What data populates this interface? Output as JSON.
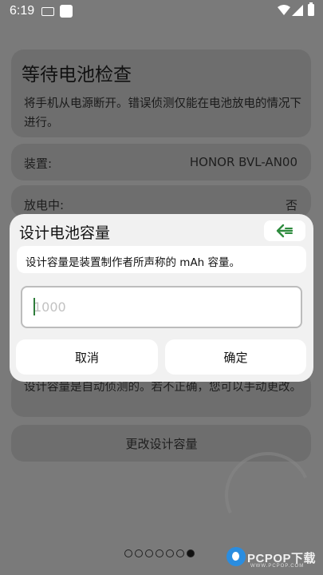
{
  "status": {
    "time": "6:19"
  },
  "page": {
    "title": "等待电池检查",
    "hint": "将手机从电源断开。错误侦测仅能在电池放电的情况下进行。",
    "device_label": "装置:",
    "device_value": "HONOR BVL-AN00",
    "discharging_label": "放电中:",
    "discharging_value": "否",
    "design_note": "设计容量是自动侦测的。若不正确，您可以手动更改。",
    "change_button": "更改设计容量",
    "pager": {
      "count": 7,
      "active_index": 6
    }
  },
  "dialog": {
    "title": "设计电池容量",
    "back_icon": "arrow-left-icon",
    "message": "设计容量是装置制作者所声称的 mAh 容量。",
    "input_value": "",
    "input_placeholder": "1000",
    "cancel_label": "取消",
    "ok_label": "确定"
  },
  "watermark": {
    "text": "PCPOP下载",
    "sub": "WWW.PCPOP.COM"
  },
  "colors": {
    "accent": "#2e8b3e",
    "scrim": "#7a7a7a",
    "dialog_bg": "#f1f1f1"
  }
}
